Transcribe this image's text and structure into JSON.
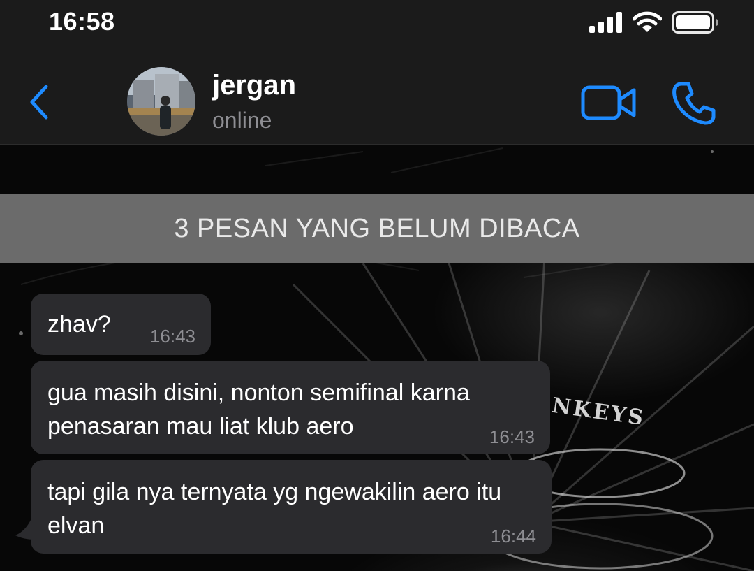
{
  "status_bar": {
    "time": "16:58",
    "icons": [
      "signal-icon",
      "wifi-icon",
      "battery-icon"
    ]
  },
  "header": {
    "contact_name": "jergan",
    "contact_status": "online",
    "icons": [
      "chevron-left-icon",
      "video-call-icon",
      "phone-icon"
    ],
    "accent_color": "#1e8bff"
  },
  "unread_banner": {
    "label": "3 PESAN YANG BELUM DIBACA"
  },
  "wallpaper": {
    "text": "NKEYS"
  },
  "messages": [
    {
      "text": "zhav?",
      "time": "16:43"
    },
    {
      "text": "gua masih disini, nonton semifinal karna penasaran mau liat klub aero",
      "time": "16:43"
    },
    {
      "text": "tapi gila nya ternyata yg ngewakilin aero itu elvan",
      "time": "16:44"
    }
  ],
  "colors": {
    "bubble": "#2b2b2e",
    "header": "#1b1b1b",
    "banner": "#6b6b6b",
    "timestamp": "#8e8e93"
  }
}
